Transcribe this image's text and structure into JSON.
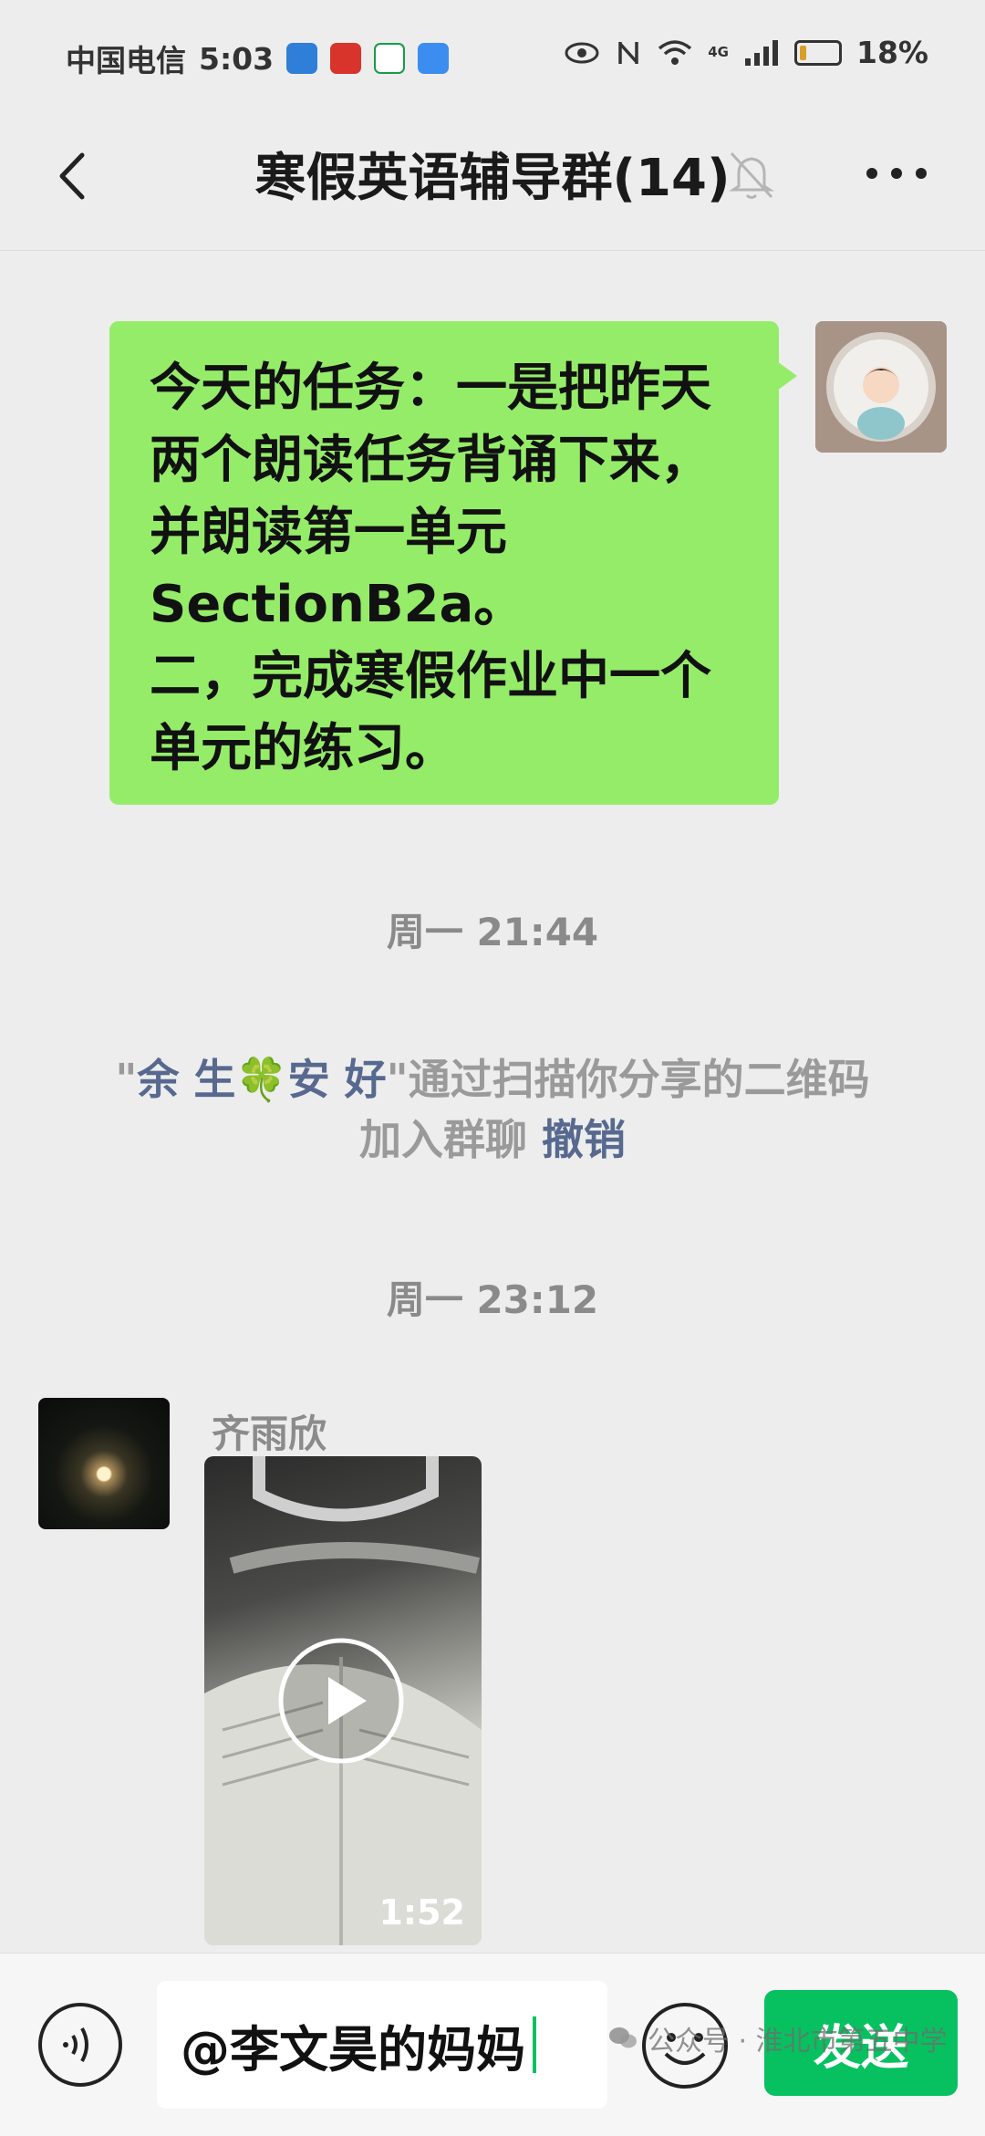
{
  "status_bar": {
    "carrier": "中国电信",
    "time": "5:03",
    "battery": "18%",
    "battery_level": 0.18,
    "network_label": "4G"
  },
  "header": {
    "title": "寒假英语辅导群(14)",
    "muted": true
  },
  "messages": {
    "outgoing_text": "今天的任务：一是把昨天\n两个朗读任务背诵下来，\n并朗读第一单元\nSectionB2a。\n二，完成寒假作业中一个\n单元的练习。",
    "time_1": "周一 21:44",
    "system_quote_open": "\"",
    "system_name": "余 生🍀安 好",
    "system_quote_close": "\"",
    "system_text": "通过扫描你分享的二维码加入群聊",
    "system_action": "撤销",
    "time_2": "周一 23:12",
    "sender_name": "齐雨欣",
    "video_duration": "1:52"
  },
  "input": {
    "value": "@李文昊的妈妈",
    "send_label": "发送"
  },
  "watermark": {
    "text": "公众号 · 淮北市第五中学"
  },
  "colors": {
    "outgoing_bubble": "#95ec69",
    "send_button": "#07c160",
    "link_blue": "#57698f",
    "background": "#ededed"
  }
}
